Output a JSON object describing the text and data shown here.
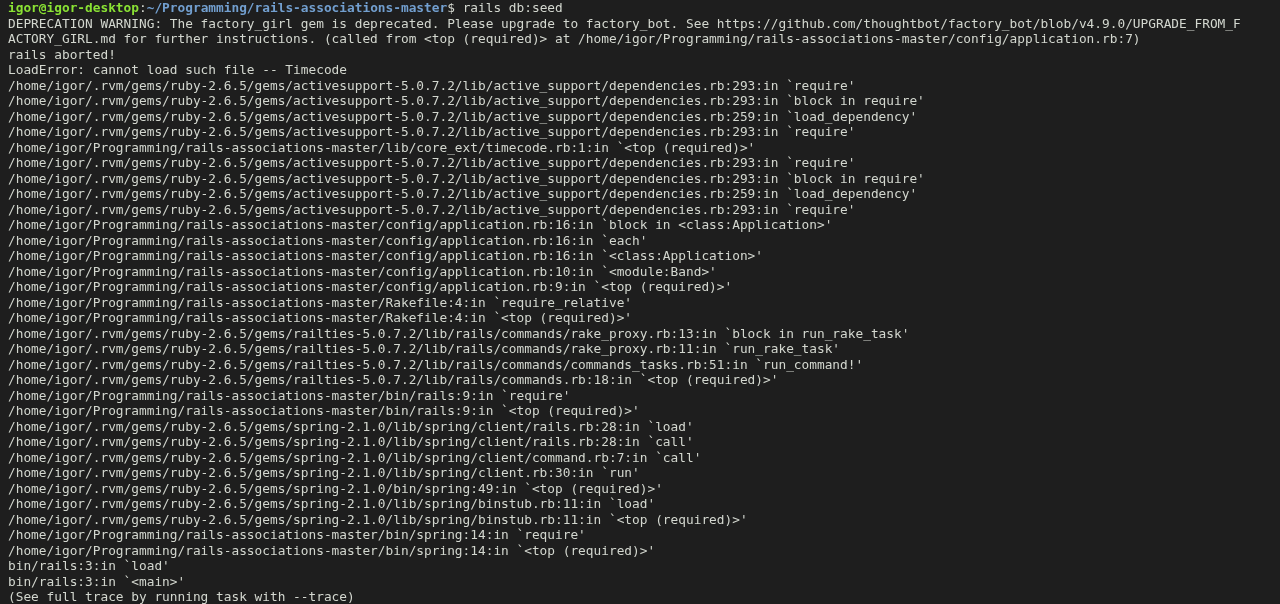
{
  "terminal": {
    "prompt": {
      "user_host": "igor@igor-desktop",
      "separator": ":",
      "path": "~/Programming/rails-associations-master",
      "symbol": "$",
      "command": "rails db:seed"
    },
    "output": [
      "DEPRECATION WARNING: The factory_girl gem is deprecated. Please upgrade to factory_bot. See https://github.com/thoughtbot/factory_bot/blob/v4.9.0/UPGRADE_FROM_FACTORY_GIRL.md for further instructions. (called from <top (required)> at /home/igor/Programming/rails-associations-master/config/application.rb:7)",
      "rails aborted!",
      "LoadError: cannot load such file -- Timecode",
      "/home/igor/.rvm/gems/ruby-2.6.5/gems/activesupport-5.0.7.2/lib/active_support/dependencies.rb:293:in `require'",
      "/home/igor/.rvm/gems/ruby-2.6.5/gems/activesupport-5.0.7.2/lib/active_support/dependencies.rb:293:in `block in require'",
      "/home/igor/.rvm/gems/ruby-2.6.5/gems/activesupport-5.0.7.2/lib/active_support/dependencies.rb:259:in `load_dependency'",
      "/home/igor/.rvm/gems/ruby-2.6.5/gems/activesupport-5.0.7.2/lib/active_support/dependencies.rb:293:in `require'",
      "/home/igor/Programming/rails-associations-master/lib/core_ext/timecode.rb:1:in `<top (required)>'",
      "/home/igor/.rvm/gems/ruby-2.6.5/gems/activesupport-5.0.7.2/lib/active_support/dependencies.rb:293:in `require'",
      "/home/igor/.rvm/gems/ruby-2.6.5/gems/activesupport-5.0.7.2/lib/active_support/dependencies.rb:293:in `block in require'",
      "/home/igor/.rvm/gems/ruby-2.6.5/gems/activesupport-5.0.7.2/lib/active_support/dependencies.rb:259:in `load_dependency'",
      "/home/igor/.rvm/gems/ruby-2.6.5/gems/activesupport-5.0.7.2/lib/active_support/dependencies.rb:293:in `require'",
      "/home/igor/Programming/rails-associations-master/config/application.rb:16:in `block in <class:Application>'",
      "/home/igor/Programming/rails-associations-master/config/application.rb:16:in `each'",
      "/home/igor/Programming/rails-associations-master/config/application.rb:16:in `<class:Application>'",
      "/home/igor/Programming/rails-associations-master/config/application.rb:10:in `<module:Band>'",
      "/home/igor/Programming/rails-associations-master/config/application.rb:9:in `<top (required)>'",
      "/home/igor/Programming/rails-associations-master/Rakefile:4:in `require_relative'",
      "/home/igor/Programming/rails-associations-master/Rakefile:4:in `<top (required)>'",
      "/home/igor/.rvm/gems/ruby-2.6.5/gems/railties-5.0.7.2/lib/rails/commands/rake_proxy.rb:13:in `block in run_rake_task'",
      "/home/igor/.rvm/gems/ruby-2.6.5/gems/railties-5.0.7.2/lib/rails/commands/rake_proxy.rb:11:in `run_rake_task'",
      "/home/igor/.rvm/gems/ruby-2.6.5/gems/railties-5.0.7.2/lib/rails/commands/commands_tasks.rb:51:in `run_command!'",
      "/home/igor/.rvm/gems/ruby-2.6.5/gems/railties-5.0.7.2/lib/rails/commands.rb:18:in `<top (required)>'",
      "/home/igor/Programming/rails-associations-master/bin/rails:9:in `require'",
      "/home/igor/Programming/rails-associations-master/bin/rails:9:in `<top (required)>'",
      "/home/igor/.rvm/gems/ruby-2.6.5/gems/spring-2.1.0/lib/spring/client/rails.rb:28:in `load'",
      "/home/igor/.rvm/gems/ruby-2.6.5/gems/spring-2.1.0/lib/spring/client/rails.rb:28:in `call'",
      "/home/igor/.rvm/gems/ruby-2.6.5/gems/spring-2.1.0/lib/spring/client/command.rb:7:in `call'",
      "/home/igor/.rvm/gems/ruby-2.6.5/gems/spring-2.1.0/lib/spring/client.rb:30:in `run'",
      "/home/igor/.rvm/gems/ruby-2.6.5/gems/spring-2.1.0/bin/spring:49:in `<top (required)>'",
      "/home/igor/.rvm/gems/ruby-2.6.5/gems/spring-2.1.0/lib/spring/binstub.rb:11:in `load'",
      "/home/igor/.rvm/gems/ruby-2.6.5/gems/spring-2.1.0/lib/spring/binstub.rb:11:in `<top (required)>'",
      "/home/igor/Programming/rails-associations-master/bin/spring:14:in `require'",
      "/home/igor/Programming/rails-associations-master/bin/spring:14:in `<top (required)>'",
      "bin/rails:3:in `load'",
      "bin/rails:3:in `<main>'",
      "(See full trace by running task with --trace)"
    ]
  }
}
